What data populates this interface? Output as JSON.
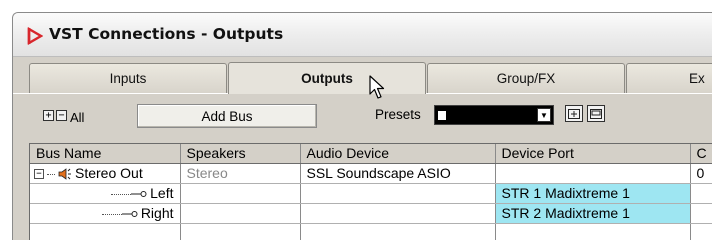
{
  "window": {
    "title": "VST Connections - Outputs"
  },
  "tabs": [
    {
      "label": "Inputs",
      "active": false
    },
    {
      "label": "Outputs",
      "active": true
    },
    {
      "label": "Group/FX",
      "active": false
    },
    {
      "label": "Ex",
      "active": false
    }
  ],
  "toolbar": {
    "expand_all_label": "All",
    "add_bus_label": "Add Bus",
    "presets_label": "Presets",
    "presets_value": ""
  },
  "table": {
    "columns": [
      "Bus Name",
      "Speakers",
      "Audio Device",
      "Device Port",
      "C"
    ],
    "rows": [
      {
        "bus_name": "Stereo Out",
        "speakers": "Stereo",
        "audio_device": "SSL Soundscape ASIO",
        "device_port": "",
        "extra": "0"
      },
      {
        "bus_name": "Left",
        "speakers": "",
        "audio_device": "",
        "device_port": "STR 1  Madixtreme 1",
        "extra": ""
      },
      {
        "bus_name": "Right",
        "speakers": "",
        "audio_device": "",
        "device_port": "STR 2  Madixtreme 1",
        "extra": ""
      }
    ]
  },
  "colors": {
    "window_bg": "#d4d0c8",
    "port_highlight": "#9ee6f2",
    "app_icon_red": "#d8262c",
    "speaker_icon": "#e3701c"
  }
}
